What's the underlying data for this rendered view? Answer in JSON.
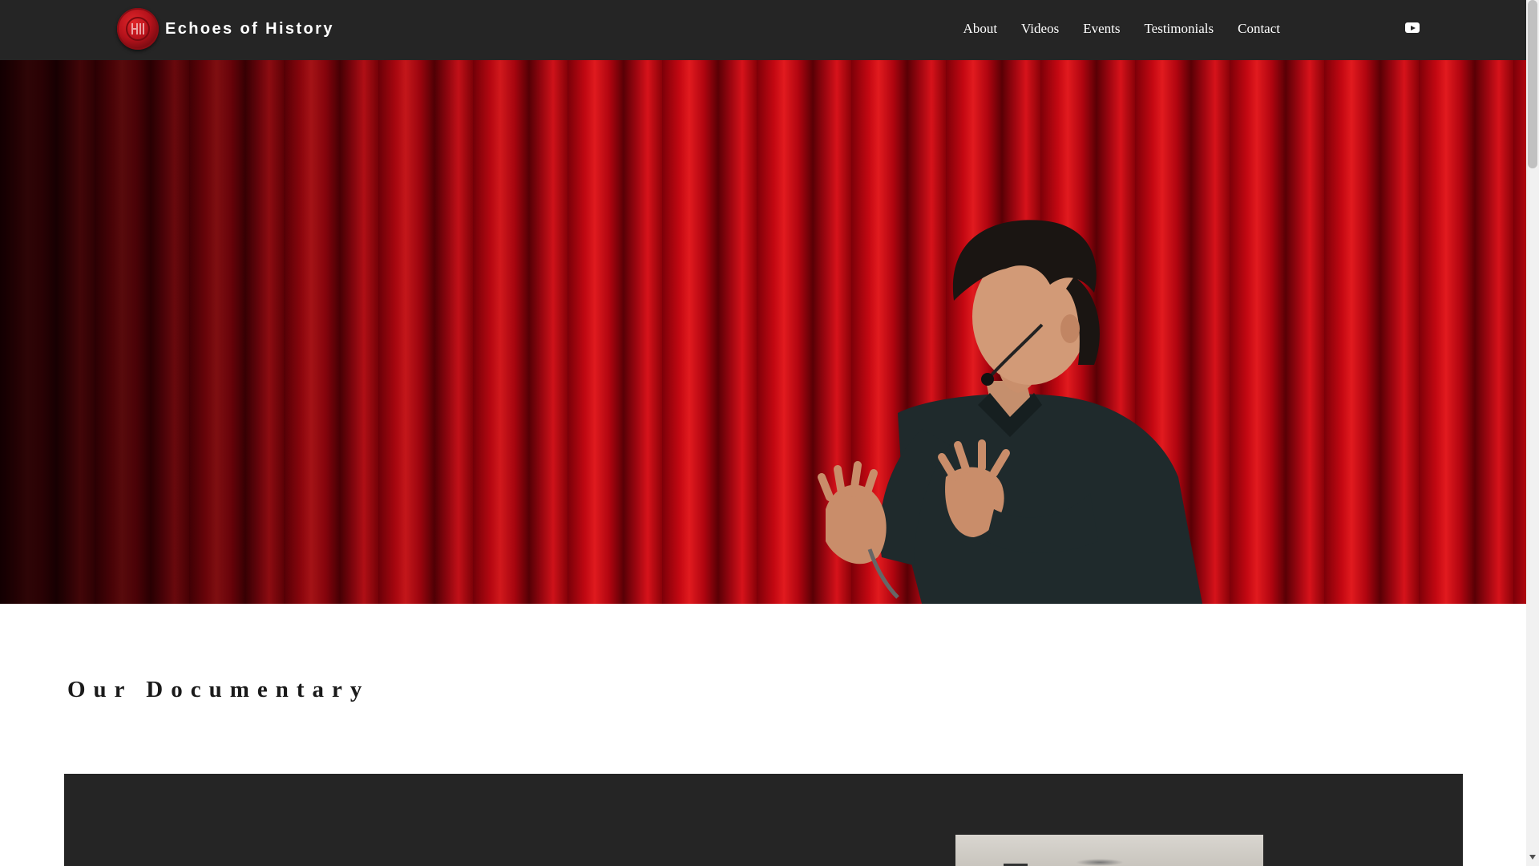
{
  "site": {
    "title": "Echoes of History",
    "brand_color": "#b5121b",
    "header_bg": "#252525"
  },
  "nav": {
    "items": [
      "About",
      "Videos",
      "Events",
      "Testimonials",
      "Contact"
    ]
  },
  "social": {
    "youtube_icon": "youtube-icon"
  },
  "hero": {
    "image": "speaker-on-stage-red-curtain"
  },
  "section": {
    "title": "Our Documentary"
  }
}
